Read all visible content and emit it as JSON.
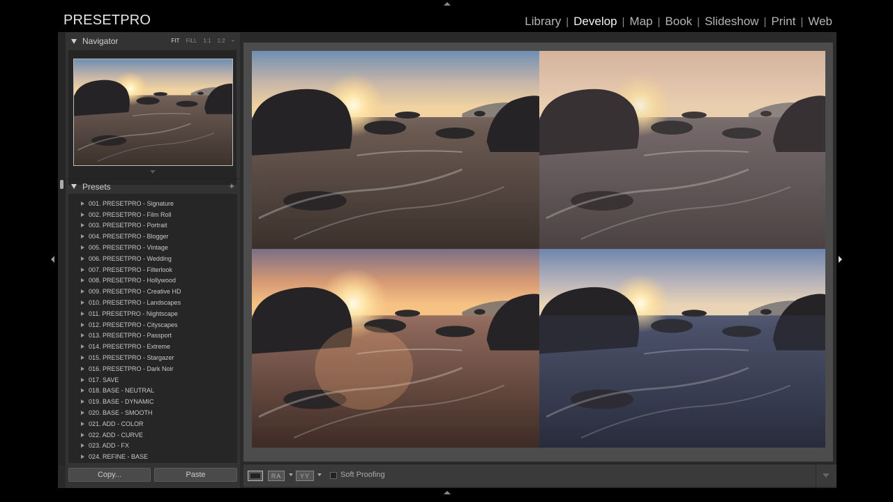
{
  "app": {
    "brand": "PRESETPRO"
  },
  "modules": [
    {
      "label": "Library",
      "active": false
    },
    {
      "label": "Develop",
      "active": true
    },
    {
      "label": "Map",
      "active": false
    },
    {
      "label": "Book",
      "active": false
    },
    {
      "label": "Slideshow",
      "active": false
    },
    {
      "label": "Print",
      "active": false
    },
    {
      "label": "Web",
      "active": false
    }
  ],
  "module_separator": "|",
  "navigator": {
    "title": "Navigator",
    "zoom_options": [
      "FIT",
      "FILL",
      "1:1",
      "1:2"
    ],
    "zoom_selected": "FIT",
    "zoom_more": "÷"
  },
  "presets": {
    "title": "Presets",
    "add_symbol": "+",
    "items": [
      "001. PRESETPRO - Signature",
      "002. PRESETPRO - Film Roll",
      "003. PRESETPRO - Portrait",
      "004. PRESETPRO - Blogger",
      "005. PRESETPRO - Vintage",
      "006. PRESETPRO - Wedding",
      "007. PRESETPRO - Filterlook",
      "008. PRESETPRO - Hollywood",
      "009. PRESETPRO - Creative HD",
      "010. PRESETPRO - Landscapes",
      "011. PRESETPRO - Nightscape",
      "012. PRESETPRO - Cityscapes",
      "013. PRESETPRO - Passport",
      "014. PRESETPRO - Extreme",
      "015. PRESETPRO - Stargazer",
      "016. PRESETPRO - Dark Noir",
      "017. SAVE",
      "018. BASE - NEUTRAL",
      "019. BASE - DYNAMIC",
      "020. BASE - SMOOTH",
      "021. ADD - COLOR",
      "022. ADD - CURVE",
      "023. ADD - FX",
      "024. REFINE - BASE"
    ]
  },
  "buttons": {
    "copy": "Copy...",
    "paste": "Paste"
  },
  "toolbar": {
    "compare_label": "RA",
    "survey_label": "YY",
    "soft_proofing": "Soft Proofing",
    "soft_proofing_checked": false
  },
  "comparison_images": [
    {
      "variant": "original",
      "tone": "warm-natural"
    },
    {
      "variant": "preset-1",
      "tone": "warm-faded"
    },
    {
      "variant": "preset-2",
      "tone": "golden-saturated"
    },
    {
      "variant": "preset-3",
      "tone": "cool-blue"
    }
  ],
  "colors": {
    "background": "#000000",
    "panel": "#333333",
    "well": "#262626",
    "main": "#4c4c4c",
    "active_module": "#f4f4f4",
    "inactive_module": "#b5b5b5"
  }
}
